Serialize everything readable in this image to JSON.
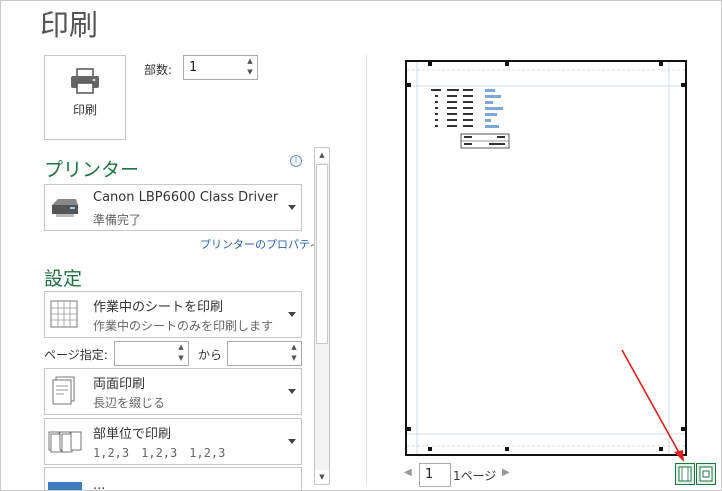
{
  "header": {
    "title": "印刷"
  },
  "print_button": {
    "label": "印刷",
    "icon": "printer-icon"
  },
  "copies": {
    "label": "部数:",
    "value": "1"
  },
  "printer": {
    "section_title": "プリンター",
    "name": "Canon LBP6600 Class Driver",
    "status": "準備完了",
    "properties_link": "プリンターのプロパティ"
  },
  "settings": {
    "section_title": "設定",
    "print_what": {
      "main": "作業中のシートを印刷",
      "sub": "作業中のシートのみを印刷します"
    },
    "pages": {
      "label": "ページ指定:",
      "to_label": "から",
      "from_value": "",
      "to_value": ""
    },
    "duplex": {
      "main": "両面印刷",
      "sub": "長辺を綴じる"
    },
    "collate": {
      "main": "部単位で印刷",
      "sub": "1,2,3　1,2,3　1,2,3"
    },
    "next_partial": "..."
  },
  "preview": {
    "page_value": "1",
    "page_suffix": "1ページ",
    "colors": {
      "accent": "#217346",
      "link": "#2e64b0",
      "annotation_arrow": "#e02020"
    }
  }
}
